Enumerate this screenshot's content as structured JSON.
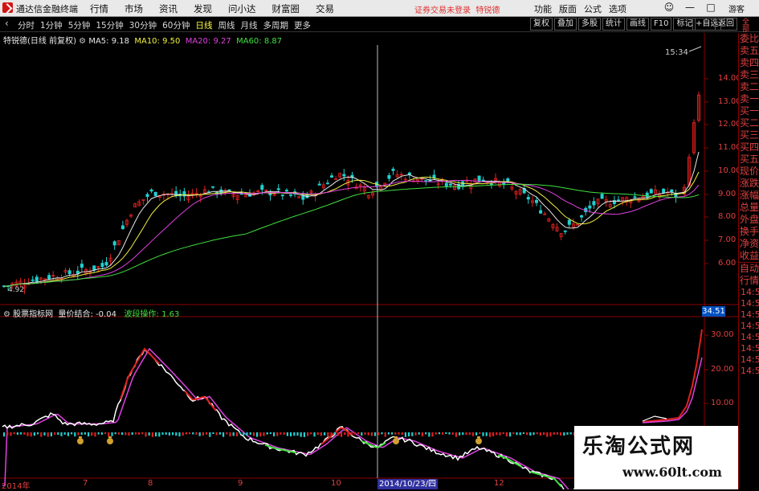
{
  "menubar": {
    "app_name": "通达信金融终端",
    "menus": [
      "行情",
      "市场",
      "资讯",
      "发现",
      "问小达",
      "财富圈",
      "交易"
    ],
    "status_text": "证券交易未登录",
    "stock_name": "特锐德",
    "right_menus": [
      "功能",
      "版面",
      "公式",
      "选项"
    ],
    "guest_label": "游客",
    "win_controls": [
      "☺",
      "—",
      "□",
      "✕"
    ]
  },
  "toolbar": {
    "periods": [
      "分时",
      "1分钟",
      "5分钟",
      "15分钟",
      "30分钟",
      "60分钟",
      "日线",
      "周线",
      "月线",
      "多周期",
      "更多"
    ],
    "active_period": "日线",
    "right_buttons": [
      "复权",
      "叠加",
      "多股",
      "统计",
      "画线",
      "F10",
      "标记"
    ],
    "add_fav": "+自选",
    "back": "返回"
  },
  "main_chart": {
    "title": "特锐德(日线 前复权)",
    "ma": [
      {
        "label": "MA5:",
        "value": "9.18",
        "color": "#e8e8e8"
      },
      {
        "label": "MA10:",
        "value": "9.50",
        "color": "#f0f040"
      },
      {
        "label": "MA20:",
        "value": "9.27",
        "color": "#e040e0"
      },
      {
        "label": "MA60:",
        "value": "8.87",
        "color": "#40e040"
      }
    ],
    "price_ticks": [
      "14.00",
      "13.00",
      "12.00",
      "11.00",
      "10.00",
      "9.00",
      "8.00",
      "7.00",
      "6.00"
    ],
    "low_label": "4.92",
    "timestamp": "15:34"
  },
  "indicator": {
    "name": "股票指标网",
    "line1_label": "量价结合:",
    "line1_value": "-0.04",
    "line2_label": "波段操作:",
    "line2_value": "1.63",
    "current_value": "34.51",
    "ticks": [
      "30.00",
      "20.00",
      "10.00"
    ]
  },
  "x_axis": {
    "labels": [
      "2014年",
      "7",
      "8",
      "9",
      "10",
      "11",
      "12"
    ],
    "cursor_date": "2014/10/23/四"
  },
  "right_column": {
    "top_items": [
      "委比",
      "卖五",
      "卖四",
      "卖三",
      "卖二",
      "卖一",
      "买一",
      "买二",
      "买三",
      "买四",
      "买五",
      "现价",
      "涨跌",
      "涨幅",
      "总量",
      "外盘",
      "换手",
      "净资",
      "收益"
    ],
    "bottom_items": [
      "自动",
      "行情"
    ],
    "times": [
      "14:50",
      "14:50",
      "14:50",
      "14:50",
      "14:50",
      "14:50",
      "14:50",
      "14:50"
    ],
    "vertical_tab": "全部"
  },
  "watermark": {
    "title": "乐淘公式网",
    "url": "www.60lt.com"
  },
  "colors": {
    "up": "#e02020",
    "down": "#20d0d0",
    "ma5": "#e8e8e8",
    "ma10": "#f0f040",
    "ma20": "#e040e0",
    "ma60": "#40e040",
    "axis": "#e04040"
  }
}
